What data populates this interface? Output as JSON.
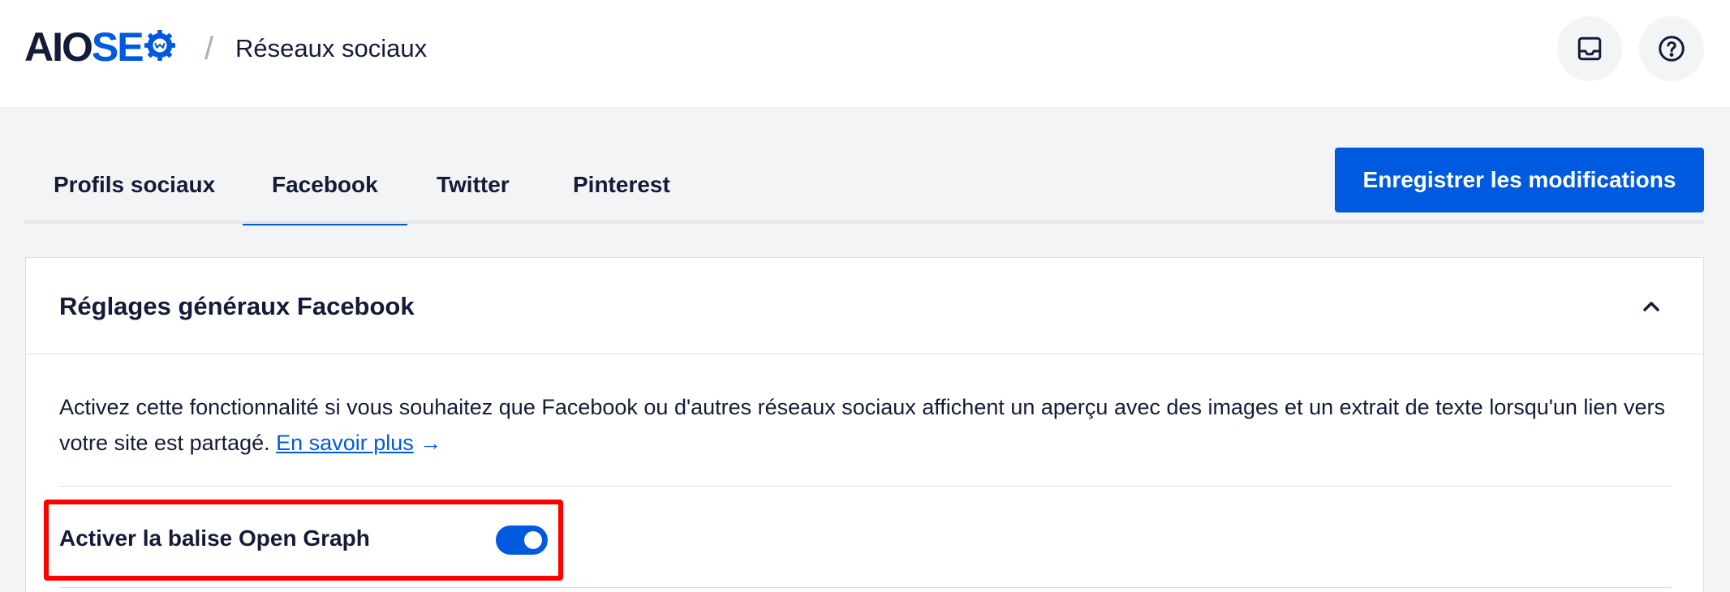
{
  "header": {
    "logo_aio": "AIO",
    "logo_seo": "SE",
    "separator": "/",
    "breadcrumb": "Réseaux sociaux"
  },
  "tabs": [
    {
      "label": "Profils sociaux",
      "active": false
    },
    {
      "label": "Facebook",
      "active": true
    },
    {
      "label": "Twitter",
      "active": false
    },
    {
      "label": "Pinterest",
      "active": false
    }
  ],
  "toolbar": {
    "save_label": "Enregistrer les modifications"
  },
  "card": {
    "title": "Réglages généraux Facebook",
    "description": "Activez cette fonctionnalité si vous souhaitez que Facebook ou d'autres réseaux sociaux affichent un aperçu avec des images et un extrait de texte lorsqu'un lien vers votre site est partagé.",
    "learn_more": "En savoir plus",
    "learn_more_arrow": "→",
    "setting_label": "Activer la balise Open Graph",
    "setting_enabled": true
  },
  "icons": {
    "inbox": "inbox-icon",
    "help": "help-icon",
    "collapse": "chevron-up-icon",
    "logo_gear": "gear-icon"
  },
  "colors": {
    "accent": "#005ae0",
    "text": "#141b38",
    "background": "#f3f4f5",
    "highlight": "#ff0000"
  }
}
